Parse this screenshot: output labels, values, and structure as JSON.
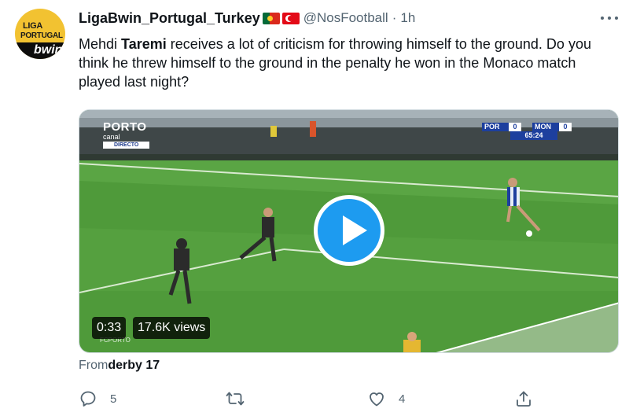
{
  "author": {
    "display_name": "LigaBwin_Portugal_Turkey",
    "flags": [
      "portugal-flag",
      "turkey-flag"
    ],
    "handle": "@NosFootball",
    "separator": "·",
    "time": "1h",
    "avatar": {
      "line1": "LIGA",
      "line2": "PORTUGAL",
      "brand": "bwin"
    }
  },
  "tweet": {
    "text_before": "Mehdi ",
    "text_bold": "Taremi",
    "text_after": " receives a lot of criticism for throwing himself to the ground. Do you think he threw himself to the ground in the penalty he won in the Monaco match played last night?"
  },
  "video": {
    "duration": "0:33",
    "views": "17.6K views",
    "broadcast_logo": {
      "line1": "PORTO",
      "line2": "canal",
      "line3": "DIRECTO"
    },
    "scorebug": {
      "home": "POR",
      "home_score": "0",
      "away": "MON",
      "away_score": "0",
      "clock": "65:24"
    },
    "bottom_logo": "FCPORTO"
  },
  "source": {
    "prefix": "From",
    "name": "derby 17"
  },
  "actions": {
    "reply_count": "5",
    "retweet_count": "",
    "like_count": "4"
  },
  "colors": {
    "accent": "#1d9bf0",
    "text_primary": "#0f1419",
    "text_secondary": "#536471",
    "pitch": "#4f9a3a"
  }
}
